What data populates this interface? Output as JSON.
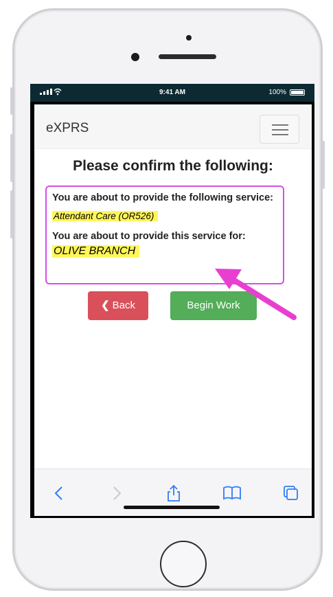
{
  "status_bar": {
    "time": "9:41 AM",
    "battery": "100%"
  },
  "navbar": {
    "brand": "eXPRS"
  },
  "main": {
    "title": "Please confirm the following:",
    "service_prompt": "You are about to provide the following service:",
    "service_name": "Attendant Care (OR526)",
    "client_prompt": "You are about to provide this service for:",
    "client_name": "OLIVE BRANCH",
    "back_label": "Back",
    "begin_label": "Begin Work"
  },
  "browser_toolbar": {
    "icons": [
      "chevron-left-icon",
      "chevron-right-icon",
      "share-icon",
      "bookmarks-icon",
      "tabs-icon"
    ]
  },
  "colors": {
    "highlight": "#fff65a",
    "annotation": "#e83fd0",
    "back_button": "#d9505a",
    "begin_button": "#54ad58",
    "ios_accent": "#2f7cf6",
    "status_bar": "#0d2a33"
  }
}
